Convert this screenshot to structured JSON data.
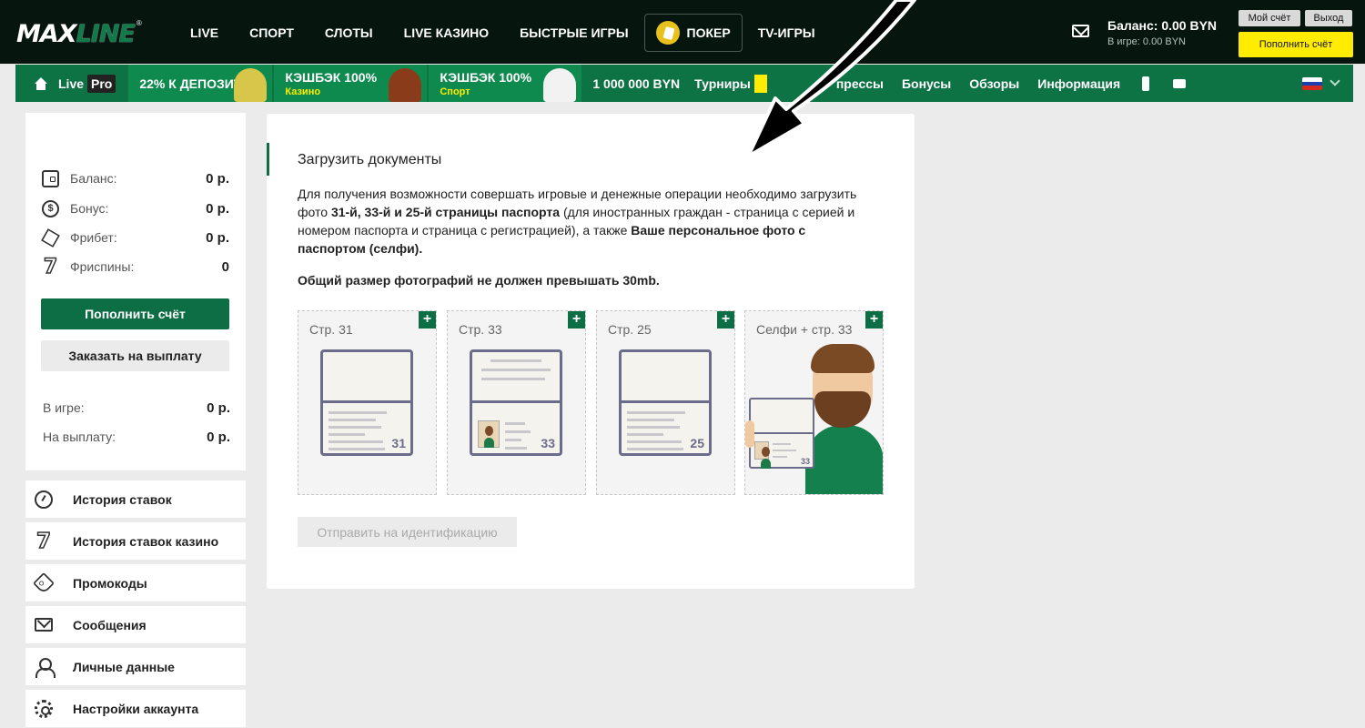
{
  "header": {
    "logo_max": "MAX",
    "logo_line": "LINE",
    "logo_reg": "®",
    "nav": [
      "LIVE",
      "СПОРТ",
      "СЛОТЫ",
      "LIVE КАЗИНО",
      "БЫСТРЫЕ ИГРЫ",
      "ПОКЕР",
      "TV-ИГРЫ"
    ],
    "balance": "Баланс: 0.00 BYN",
    "in_game": "В игре: 0.00 BYN",
    "my_account": "Мой счёт",
    "logout": "Выход",
    "deposit": "Пополнить счёт"
  },
  "subnav": {
    "live": "Live",
    "pro": "Pro",
    "promo1": {
      "title": "22% К ДЕПОЗИТУ"
    },
    "promo2": {
      "title": "КЭШБЭК 100%",
      "sub": "Казино"
    },
    "promo3": {
      "title": "КЭШБЭК 100%",
      "sub": "Спорт"
    },
    "jackpot": "1 000 000 BYN",
    "tournaments": "Турниры",
    "express": "прессы",
    "bonuses": "Бонусы",
    "reviews": "Обзоры",
    "info": "Информация",
    "flag_colors": [
      "#ffffff",
      "#1c3fae",
      "#d52b1e"
    ]
  },
  "sidebar": {
    "balance_label": "Баланс:",
    "balance_value": "0 р.",
    "bonus_label": "Бонус:",
    "bonus_value": "0 р.",
    "freebet_label": "Фрибет:",
    "freebet_value": "0 р.",
    "freespins_label": "Фриспины:",
    "freespins_value": "0",
    "deposit_btn": "Пополнить счёт",
    "withdraw_btn": "Заказать на выплату",
    "ingame_label": "В игре:",
    "ingame_value": "0 р.",
    "payout_label": "На выплату:",
    "payout_value": "0 р.",
    "menu": [
      "История ставок",
      "История ставок казино",
      "Промокоды",
      "Сообщения",
      "Личные данные",
      "Настройки аккаунта"
    ]
  },
  "main": {
    "title": "Загрузить документы",
    "desc_1": "Для получения возможности совершать игровые и денежные операции необходимо загрузить фото ",
    "desc_b1": "31-й, 33-й и 25-й страницы паспорта",
    "desc_2": " (для иностранных граждан - страница с серией и номером паспорта и страница с регистрацией), а также ",
    "desc_b2": "Ваше персональное фото с паспортом (селфи).",
    "size_note": "Общий размер фотографий не должен превышать 30mb.",
    "cards": [
      {
        "label": "Стр. 31",
        "num": "31"
      },
      {
        "label": "Стр. 33",
        "num": "33"
      },
      {
        "label": "Стр. 25",
        "num": "25"
      },
      {
        "label": "Селфи + стр. 33",
        "num": "33"
      }
    ],
    "plus": "+",
    "submit": "Отправить на идентификацию"
  },
  "colors": {
    "brand_green": "#0d7244",
    "accent_yellow": "#ffec00",
    "dark": "#06160f"
  }
}
